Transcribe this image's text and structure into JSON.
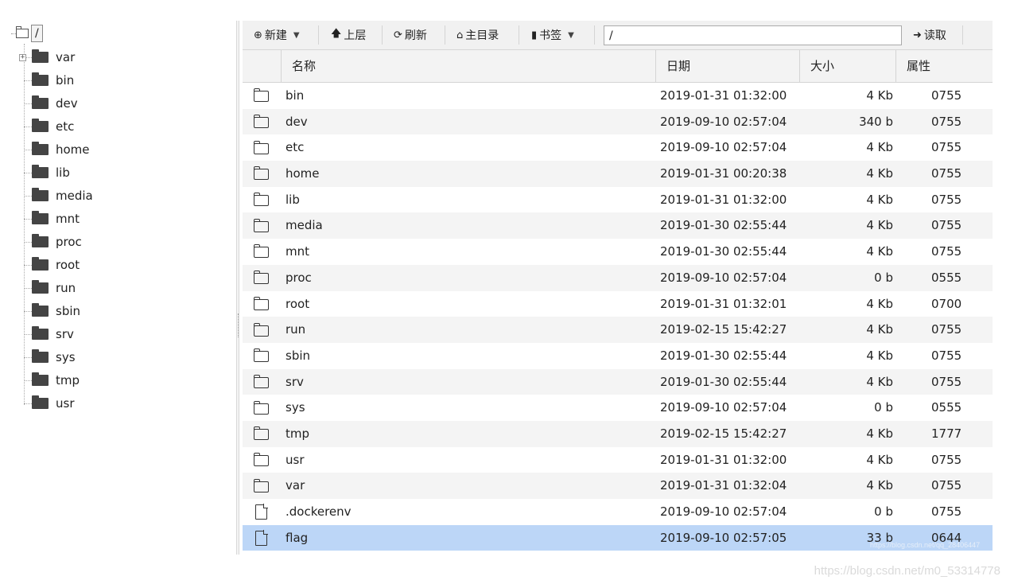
{
  "tree": {
    "root_label": "/",
    "expander_symbol": "+",
    "items": [
      {
        "label": "var",
        "expandable": true
      },
      {
        "label": "bin"
      },
      {
        "label": "dev"
      },
      {
        "label": "etc"
      },
      {
        "label": "home"
      },
      {
        "label": "lib"
      },
      {
        "label": "media"
      },
      {
        "label": "mnt"
      },
      {
        "label": "proc"
      },
      {
        "label": "root"
      },
      {
        "label": "run"
      },
      {
        "label": "sbin"
      },
      {
        "label": "srv"
      },
      {
        "label": "sys"
      },
      {
        "label": "tmp"
      },
      {
        "label": "usr"
      }
    ]
  },
  "toolbar": {
    "new_label": "新建",
    "up_label": "上层",
    "refresh_label": "刷新",
    "home_label": "主目录",
    "bookmark_label": "书签",
    "path_value": "/",
    "read_label": "读取"
  },
  "table": {
    "columns": {
      "name": "名称",
      "date": "日期",
      "size": "大小",
      "attr": "属性"
    },
    "rows": [
      {
        "type": "folder",
        "name": "bin",
        "date": "2019-01-31 01:32:00",
        "size": "4 Kb",
        "attr": "0755"
      },
      {
        "type": "folder",
        "name": "dev",
        "date": "2019-09-10 02:57:04",
        "size": "340 b",
        "attr": "0755"
      },
      {
        "type": "folder",
        "name": "etc",
        "date": "2019-09-10 02:57:04",
        "size": "4 Kb",
        "attr": "0755"
      },
      {
        "type": "folder",
        "name": "home",
        "date": "2019-01-31 00:20:38",
        "size": "4 Kb",
        "attr": "0755"
      },
      {
        "type": "folder",
        "name": "lib",
        "date": "2019-01-31 01:32:00",
        "size": "4 Kb",
        "attr": "0755"
      },
      {
        "type": "folder",
        "name": "media",
        "date": "2019-01-30 02:55:44",
        "size": "4 Kb",
        "attr": "0755"
      },
      {
        "type": "folder",
        "name": "mnt",
        "date": "2019-01-30 02:55:44",
        "size": "4 Kb",
        "attr": "0755"
      },
      {
        "type": "folder",
        "name": "proc",
        "date": "2019-09-10 02:57:04",
        "size": "0 b",
        "attr": "0555"
      },
      {
        "type": "folder",
        "name": "root",
        "date": "2019-01-31 01:32:01",
        "size": "4 Kb",
        "attr": "0700"
      },
      {
        "type": "folder",
        "name": "run",
        "date": "2019-02-15 15:42:27",
        "size": "4 Kb",
        "attr": "0755"
      },
      {
        "type": "folder",
        "name": "sbin",
        "date": "2019-01-30 02:55:44",
        "size": "4 Kb",
        "attr": "0755"
      },
      {
        "type": "folder",
        "name": "srv",
        "date": "2019-01-30 02:55:44",
        "size": "4 Kb",
        "attr": "0755"
      },
      {
        "type": "folder",
        "name": "sys",
        "date": "2019-09-10 02:57:04",
        "size": "0 b",
        "attr": "0555"
      },
      {
        "type": "folder",
        "name": "tmp",
        "date": "2019-02-15 15:42:27",
        "size": "4 Kb",
        "attr": "1777"
      },
      {
        "type": "folder",
        "name": "usr",
        "date": "2019-01-31 01:32:00",
        "size": "4 Kb",
        "attr": "0755"
      },
      {
        "type": "folder",
        "name": "var",
        "date": "2019-01-31 01:32:04",
        "size": "4 Kb",
        "attr": "0755"
      },
      {
        "type": "file",
        "name": ".dockerenv",
        "date": "2019-09-10 02:57:04",
        "size": "0 b",
        "attr": "0755"
      },
      {
        "type": "file",
        "name": "flag",
        "date": "2019-09-10 02:57:05",
        "size": "33 b",
        "attr": "0644",
        "selected": true
      }
    ]
  },
  "colors": {
    "selected_row": "#bcd6f7",
    "alt_row": "#f4f4f4",
    "toolbar_bg": "#f1f1f1"
  },
  "icons": {
    "folder": "folder-icon",
    "file": "file-icon"
  },
  "watermark": {
    "main": "https://blog.csdn.net/m0_53314778",
    "faint": "https://blog.csdn.net/qq_28406447"
  }
}
